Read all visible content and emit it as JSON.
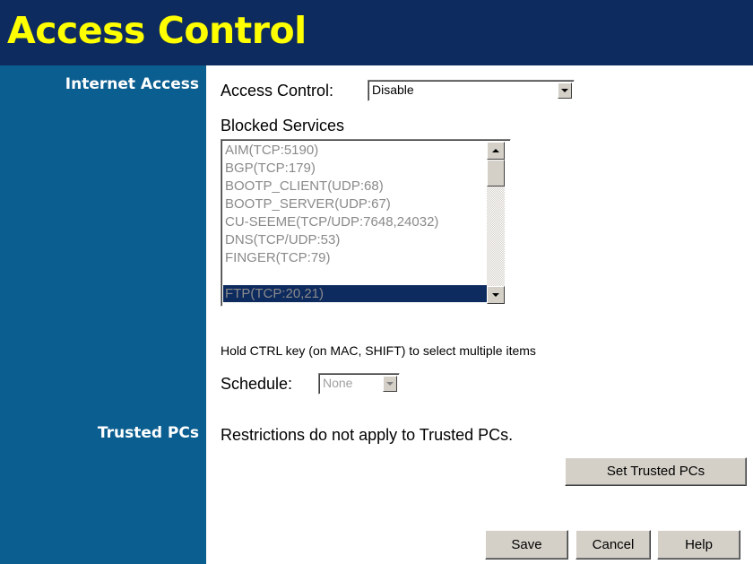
{
  "header": {
    "title": "Access Control"
  },
  "sidebar": {
    "internet_access_label": "Internet Access",
    "trusted_pcs_label": "Trusted PCs"
  },
  "access_control": {
    "label": "Access Control:",
    "selected_value": "Disable"
  },
  "blocked_services": {
    "label": "Blocked Services",
    "items": [
      "AIM(TCP:5190)",
      "BGP(TCP:179)",
      "BOOTP_CLIENT(UDP:68)",
      "BOOTP_SERVER(UDP:67)",
      "CU-SEEME(TCP/UDP:7648,24032)",
      "DNS(TCP/UDP:53)",
      "FINGER(TCP:79)",
      "FTP(TCP:20,21)"
    ],
    "selected_index": 7
  },
  "hint": "Hold CTRL key (on MAC, SHIFT) to select multiple items",
  "schedule": {
    "label": "Schedule:",
    "selected_value": "None"
  },
  "trusted_pcs": {
    "description": "Restrictions do not apply to Trusted PCs.",
    "button_label": "Set Trusted PCs"
  },
  "footer": {
    "save_label": "Save",
    "cancel_label": "Cancel",
    "help_label": "Help"
  },
  "colors": {
    "header_bg": "#0e2b5f",
    "title_color": "#ffff00",
    "sidebar_bg": "#0b5e90",
    "selection_bg": "#0e2b5f",
    "disabled_text": "#8a8a8a"
  }
}
